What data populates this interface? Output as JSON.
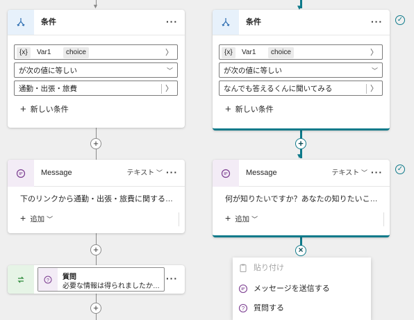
{
  "condition_left": {
    "title": "条件",
    "more_label": "···",
    "variable_chip": "{x}",
    "variable_name": "Var1",
    "variable_type": "choice",
    "operator": "が次の値に等しい",
    "value": "通勤・出張・旅費",
    "add_condition": "新しい条件"
  },
  "condition_right": {
    "title": "条件",
    "more_label": "···",
    "variable_chip": "{x}",
    "variable_name": "Var1",
    "variable_type": "choice",
    "operator": "が次の値に等しい",
    "value": "なんでも答えるくんに聞いてみる",
    "add_condition": "新しい条件"
  },
  "message_left": {
    "title": "Message",
    "type_label": "テキスト",
    "more_label": "···",
    "text": "下のリンクから通勤・出張・旅費に関する…",
    "add_label": "追加"
  },
  "message_right": {
    "title": "Message",
    "type_label": "テキスト",
    "more_label": "···",
    "text": "何が知りたいですか？あなたの知りたいこ…",
    "add_label": "追加"
  },
  "question_node": {
    "title": "質問",
    "text": "必要な情報は得られましたか…",
    "more_label": "···"
  },
  "add_menu": {
    "items": [
      {
        "label": "貼り付け",
        "icon": "paste-icon",
        "enabled": false
      },
      {
        "label": "メッセージを送信する",
        "icon": "message-icon",
        "enabled": true
      },
      {
        "label": "質問する",
        "icon": "question-icon",
        "enabled": true
      }
    ]
  },
  "connector_buttons": {
    "add_symbol": "+",
    "close_symbol": "×"
  },
  "colors": {
    "accent_teal": "#0e7a8a",
    "condition_icon_bg": "#e7f1fb",
    "message_icon_bg": "#f3ecf6",
    "question_icon_bg": "#e6f4e6",
    "canvas_bg": "#efefef"
  }
}
